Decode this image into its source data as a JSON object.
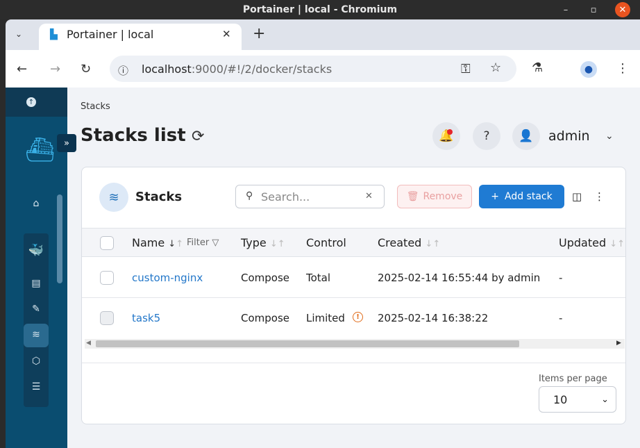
{
  "window": {
    "title": "Portainer | local - Chromium"
  },
  "browser": {
    "tab_title": "Portainer | local",
    "url_host": "localhost",
    "url_path": ":9000/#!/2/docker/stacks"
  },
  "page": {
    "breadcrumb": "Stacks",
    "title": "Stacks list",
    "user": "admin"
  },
  "card": {
    "title": "Stacks",
    "search_placeholder": "Search...",
    "remove_label": "Remove",
    "add_label": "Add stack"
  },
  "table": {
    "headers": {
      "name": "Name",
      "filter": "Filter",
      "type": "Type",
      "control": "Control",
      "created": "Created",
      "updated": "Updated"
    },
    "rows": [
      {
        "name": "custom-nginx",
        "type": "Compose",
        "control": "Total",
        "created": "2025-02-14 16:55:44 by admin",
        "updated": "-"
      },
      {
        "name": "task5",
        "type": "Compose",
        "control": "Limited",
        "created": "2025-02-14 16:38:22",
        "updated": "-"
      }
    ]
  },
  "pagination": {
    "label": "Items per page",
    "value": "10"
  },
  "colors": {
    "sidebar": "#0a4d70",
    "primary": "#1f7bd3",
    "link": "#2377c9",
    "warning": "#e06c1a"
  }
}
